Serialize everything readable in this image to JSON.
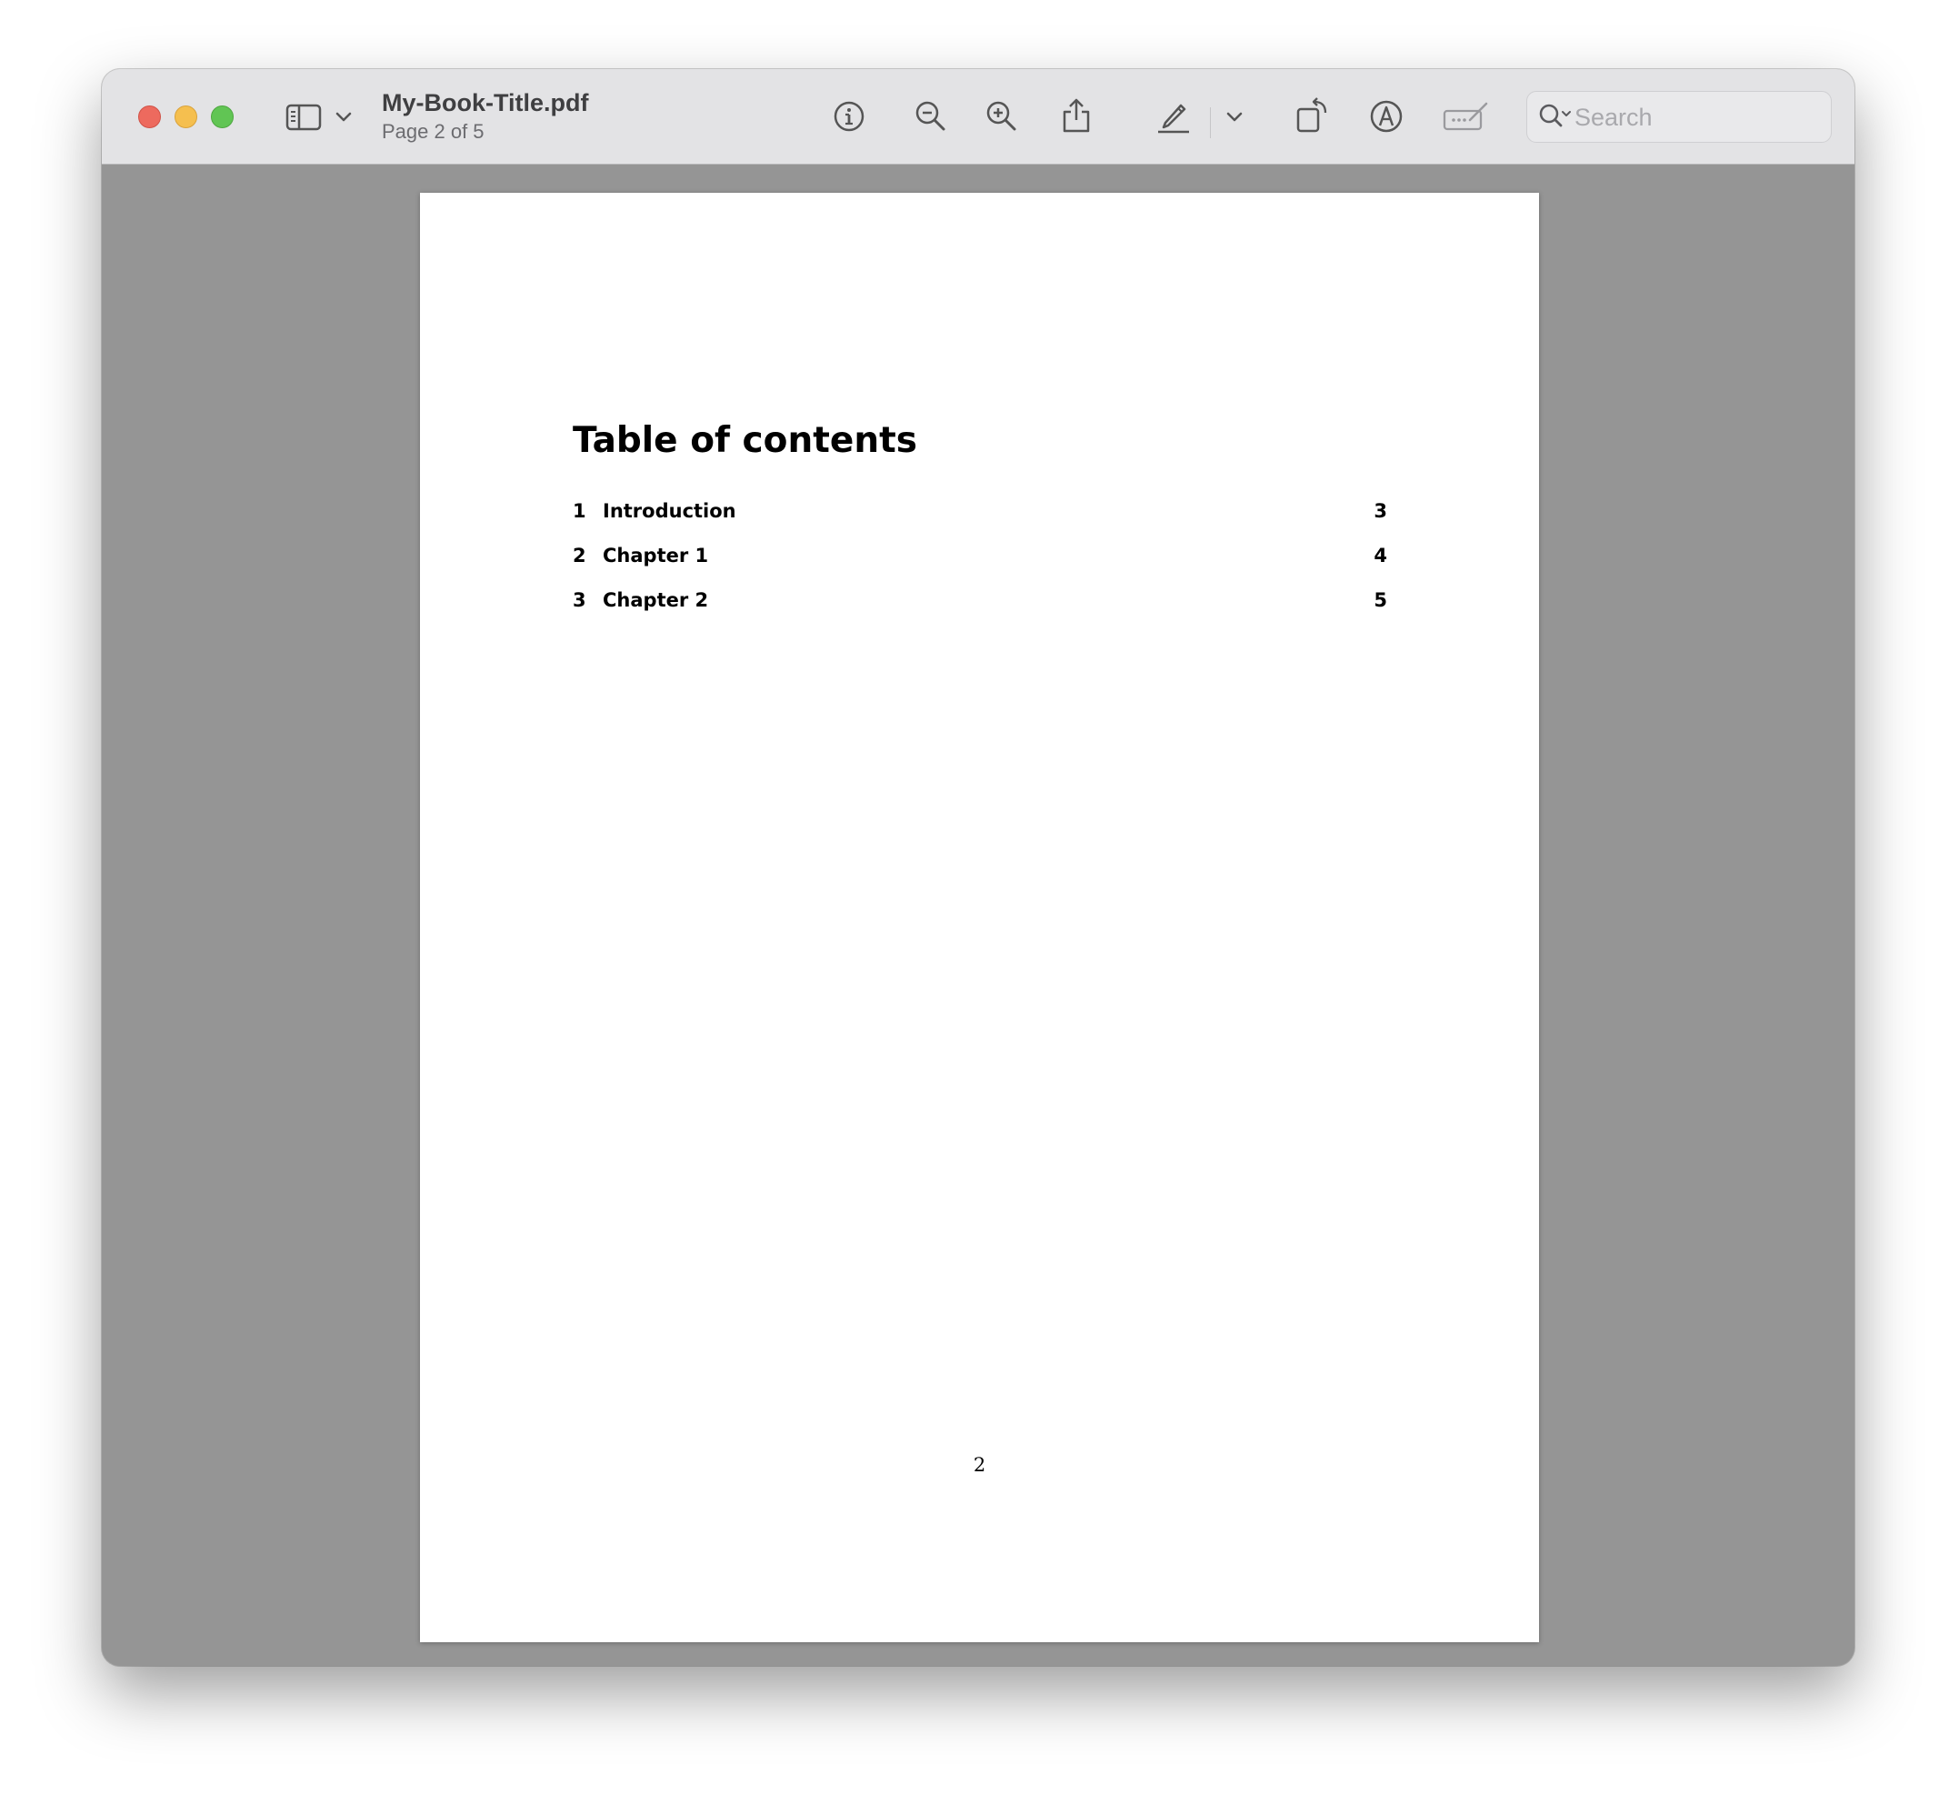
{
  "window": {
    "doc_title": "My-Book-Title.pdf",
    "doc_subtitle": "Page 2 of 5"
  },
  "toolbar": {
    "icons": [
      "sidebar-icon",
      "chevron-down-icon",
      "info-icon",
      "zoom-out-icon",
      "zoom-in-icon",
      "share-icon",
      "highlight-pen-icon",
      "chevron-down-icon",
      "rotate-icon",
      "markup-icon",
      "signature-icon"
    ],
    "search_placeholder": "Search"
  },
  "document": {
    "heading": "Table of contents",
    "toc": [
      {
        "number": "1",
        "label": "Introduction",
        "page": "3"
      },
      {
        "number": "2",
        "label": "Chapter 1",
        "page": "4"
      },
      {
        "number": "3",
        "label": "Chapter 2",
        "page": "5"
      }
    ],
    "page_number": "2"
  },
  "colors": {
    "close": "#ed6a5e",
    "minimize": "#f5bf4f",
    "maximize": "#61c554",
    "titlebar": "#e3e3e5",
    "canvas": "#959595"
  }
}
